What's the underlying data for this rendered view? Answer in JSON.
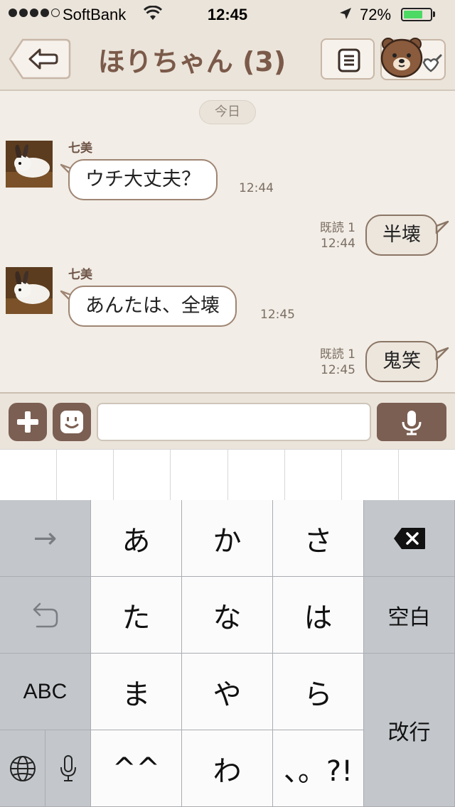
{
  "status_bar": {
    "carrier": "SoftBank",
    "time": "12:45",
    "battery_percent": "72%",
    "battery_level": 0.72,
    "signal_bars": 4,
    "signal_max": 5
  },
  "nav": {
    "title": "ほりちゃん (3)",
    "icons": [
      "back-arrow-icon",
      "menu-list-icon",
      "friend-bear-icon"
    ]
  },
  "chat": {
    "date_label": "今日",
    "messages": [
      {
        "side": "left",
        "sender": "七美",
        "text": "ウチ大丈夫？",
        "time": "12:44"
      },
      {
        "side": "right",
        "read": "既読 1",
        "text": "半壊",
        "time": "12:44"
      },
      {
        "side": "left",
        "sender": "七美",
        "text": "あんたは、全壊",
        "time": "12:45"
      },
      {
        "side": "right",
        "read": "既読 1",
        "text": "鬼笑",
        "time": "12:45"
      }
    ]
  },
  "input": {
    "value": "",
    "icons": [
      "plus-icon",
      "emoji-icon",
      "microphone-icon"
    ]
  },
  "keyboard": {
    "row1": {
      "left": "→",
      "keys": [
        "あ",
        "か",
        "さ"
      ]
    },
    "row2": {
      "keys": [
        "た",
        "な",
        "は"
      ],
      "right": "空白"
    },
    "row3": {
      "left": "ABC",
      "keys": [
        "ま",
        "や",
        "ら"
      ],
      "right": "改行"
    },
    "row4": {
      "keys": [
        "^^",
        "わ",
        "、。?!"
      ]
    }
  },
  "colors": {
    "brand_brown": "#7b5a4a",
    "header_bg": "#ebe4da",
    "chat_bg": "#f2ede6",
    "battery_green": "#4cd964"
  }
}
